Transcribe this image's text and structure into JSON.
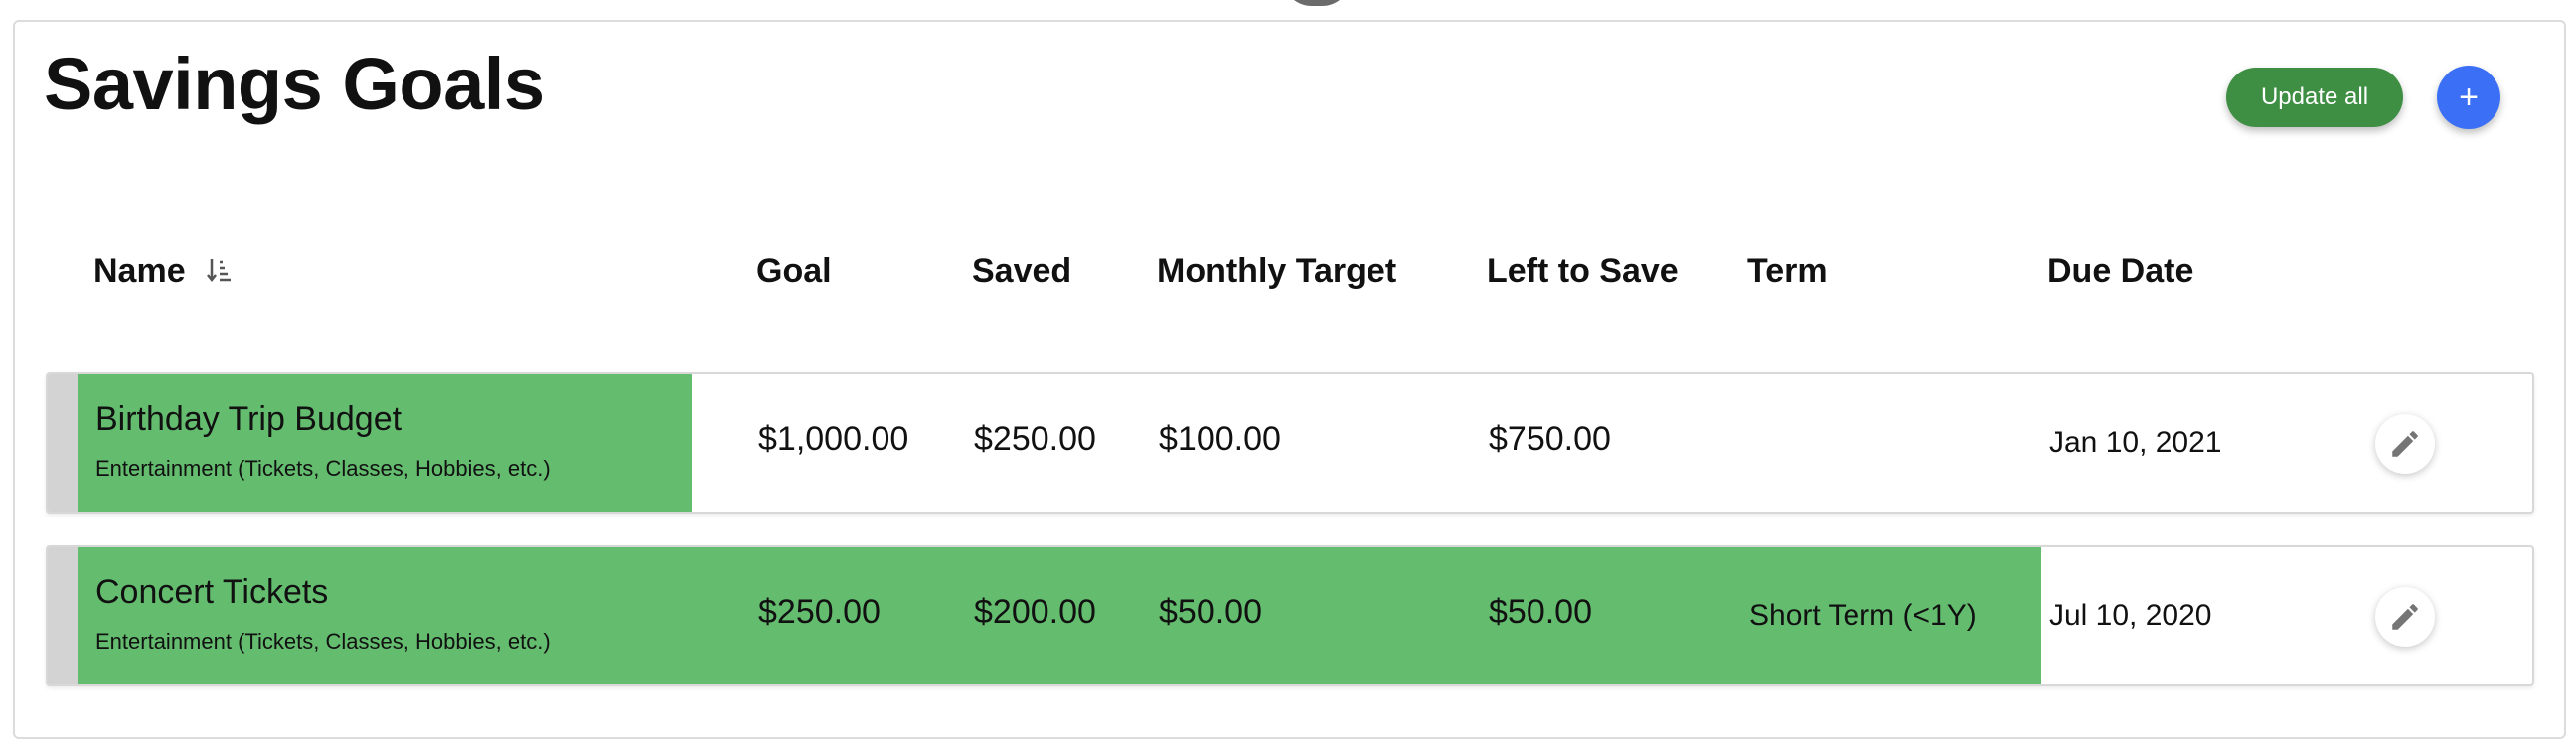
{
  "header": {
    "title": "Savings Goals",
    "update_label": "Update all",
    "add_label": "+"
  },
  "columns": {
    "name": "Name",
    "goal": "Goal",
    "saved": "Saved",
    "monthly": "Monthly Target",
    "left": "Left to Save",
    "term": "Term",
    "due": "Due Date"
  },
  "rows": [
    {
      "name": "Birthday Trip Budget",
      "category": "Entertainment (Tickets, Classes, Hobbies, etc.)",
      "goal": "$1,000.00",
      "saved": "$250.00",
      "monthly": "$100.00",
      "left": "$750.00",
      "term": "",
      "due": "Jan 10, 2021",
      "progress": 0.25
    },
    {
      "name": "Concert Tickets",
      "category": "Entertainment (Tickets, Classes, Hobbies, etc.)",
      "goal": "$250.00",
      "saved": "$200.00",
      "monthly": "$50.00",
      "left": "$50.00",
      "term": "Short Term (<1Y)",
      "due": "Jul 10, 2020",
      "progress": 0.8
    }
  ],
  "colors": {
    "progress": "#64bd6f",
    "update_button": "#3e8e43",
    "add_button": "#3b6ff5"
  },
  "icons": {
    "sort": "sort-ascending-icon",
    "edit": "pencil-icon"
  }
}
